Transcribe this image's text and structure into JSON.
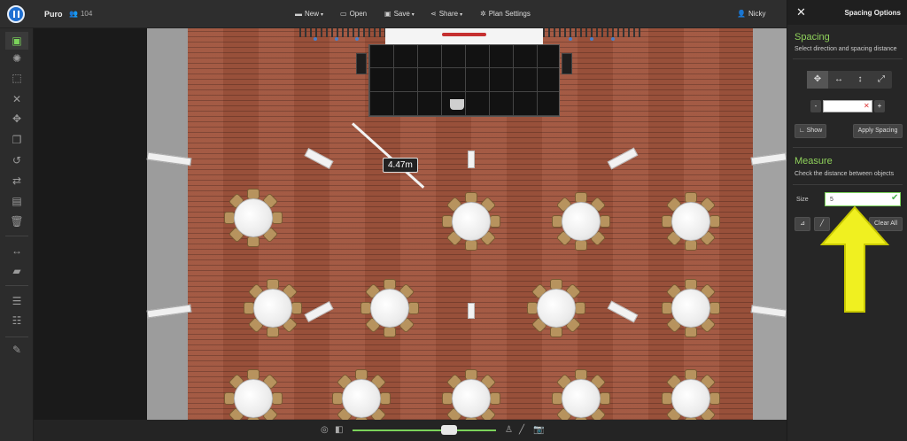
{
  "topbar": {
    "project_name": "Puro",
    "user_count": "104",
    "menu": [
      {
        "label": "New",
        "icon": "file-icon",
        "glyph": "▬"
      },
      {
        "label": "Open",
        "icon": "folder-icon",
        "glyph": "▭"
      },
      {
        "label": "Save",
        "icon": "save-icon",
        "glyph": "▣"
      },
      {
        "label": "Share",
        "icon": "share-icon",
        "glyph": "⋖"
      },
      {
        "label": "Plan Settings",
        "icon": "gear-icon",
        "glyph": "✲"
      }
    ],
    "user_name": "Nicky"
  },
  "canvas": {
    "measure_label": "4.47m"
  },
  "panel": {
    "title": "Spacing Options",
    "spacing": {
      "title": "Spacing",
      "subtitle": "Select direction and spacing distance",
      "minus": "-",
      "plus": "+",
      "input_value": "",
      "show_label": "Show",
      "apply_label": "Apply Spacing"
    },
    "measure": {
      "title": "Measure",
      "subtitle": "Check the distance between objects",
      "size_label": "Size",
      "size_value": "5",
      "clear_label": "Clear All"
    }
  },
  "colors": {
    "accent": "#8fd15b",
    "arrow": "#f0f020",
    "floor": "#a0543d"
  }
}
